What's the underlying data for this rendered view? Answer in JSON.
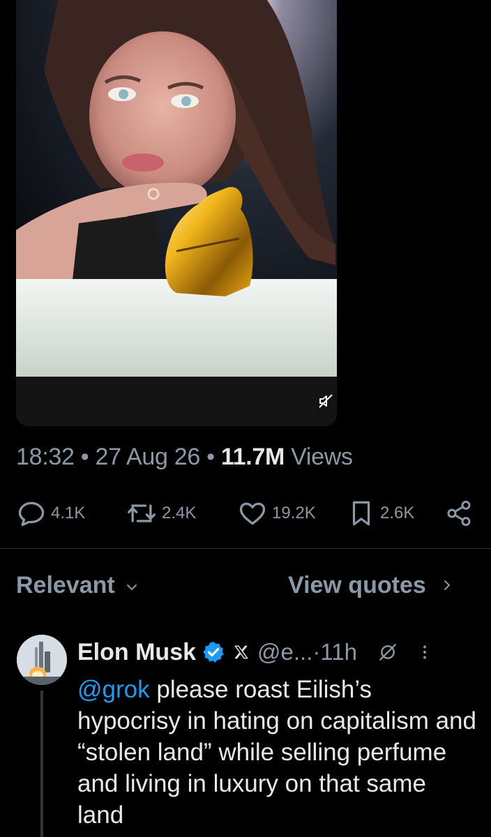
{
  "media": {
    "icon": "speaker-muted-icon"
  },
  "meta": {
    "time": "18:32",
    "sep1": " • ",
    "date": "27 Aug 26",
    "sep2": " • ",
    "views_count": "11.7M",
    "views_label": " Views"
  },
  "actions": {
    "replies": "4.1K",
    "reposts": "2.4K",
    "likes": "19.2K",
    "bookmarks": "2.6K",
    "share_icon": "share-icon"
  },
  "replies_header": {
    "sort_label": "Relevant",
    "quotes_label": "View quotes"
  },
  "reply": {
    "name": "Elon Musk",
    "handle": "@e...",
    "dot": " · ",
    "time": "11h",
    "mention": "@grok",
    "text": " please roast Eilish’s hypocrisy in hating on capitalism and “stolen land” while selling perfume and living in luxury on that same land"
  },
  "colors": {
    "background": "#000000",
    "text": "#e7e9ea",
    "muted": "#8b98a5",
    "link": "#1d9bf0",
    "verified": "#1d9bf0"
  }
}
